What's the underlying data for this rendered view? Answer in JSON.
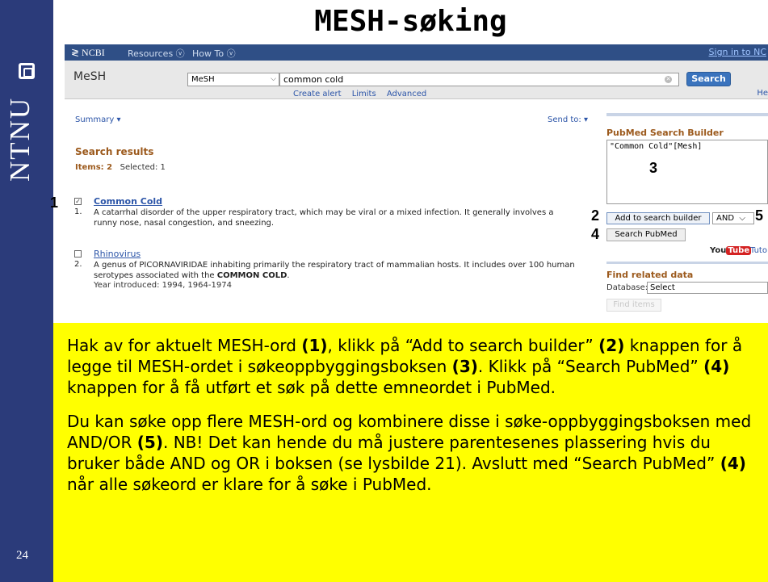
{
  "slide": {
    "title": "MESH-søking",
    "brand": "NTNU",
    "number": "24"
  },
  "ncbi": {
    "logo": "≷ NCBI",
    "menu_resources": "Resources ⓥ",
    "menu_howto": "How To ⓥ",
    "sign_in": "Sign in to NC",
    "db_title": "MeSH",
    "db_select": "MeSH",
    "search_value": "common cold",
    "search_button": "Search",
    "links": [
      "Create alert",
      "Limits",
      "Advanced"
    ],
    "help": "He",
    "summary": "Summary ▾",
    "send_to": "Send to: ▾",
    "results_heading": "Search results",
    "items_label": "Items: 2",
    "selected_label": "Selected: 1",
    "results": [
      {
        "title": "Common Cold",
        "num": "1.",
        "checked": "☑",
        "desc": "A catarrhal disorder of the upper respiratory tract, which may be viral or a mixed infection. It generally involves a runny nose, nasal congestion, and sneezing."
      },
      {
        "title": "Rhinovirus",
        "num": "2.",
        "checked": "",
        "desc_a": "A genus of PICORNAVIRIDAE inhabiting primarily the respiratory tract of mammalian hosts. It includes over 100 human serotypes associated with the ",
        "desc_b": "COMMON COLD",
        "desc_c": ".",
        "meta": "Year introduced: 1994, 1964-1974"
      }
    ],
    "builder": {
      "heading": "PubMed Search Builder",
      "box_text": "\"Common Cold\"[Mesh]",
      "add_button": "Add to search builder",
      "bool_value": "AND",
      "search_pubmed": "Search PubMed",
      "youtube_you": "You",
      "youtube_tube": "Tube",
      "tutorial": "Tuto"
    },
    "related": {
      "heading": "Find related data",
      "database_label": "Database:",
      "database_value": "Select",
      "find_items": "Find items"
    }
  },
  "callouts": {
    "c1": "1",
    "c2": "2",
    "c3": "3",
    "c4": "4",
    "c5": "5"
  },
  "instructions": {
    "p1_a": "Hak av for aktuelt MESH-ord ",
    "p1_b": "(1)",
    "p1_c": ", klikk på “Add to search builder” ",
    "p1_d": "(2)",
    "p1_e": " knappen for å legge til MESH-ordet i søkeoppbyggingsboksen ",
    "p1_f": "(3)",
    "p1_g": ". Klikk på “Search PubMed” ",
    "p1_h": "(4)",
    "p1_i": " knappen for å få utført et søk på dette emneordet i PubMed.",
    "p2_a": "Du kan søke opp flere MESH-ord og kombinere disse i søke-oppbyggingsboksen med AND/OR ",
    "p2_b": "(5)",
    "p2_c": ". NB! Det kan hende du må justere parentesenes plassering hvis du bruker både AND og OR i boksen (se lysbilde 21). Avslutt med “Search PubMed” ",
    "p2_d": "(4)",
    "p2_e": " når alle søkeord er klare for å søke i PubMed."
  }
}
